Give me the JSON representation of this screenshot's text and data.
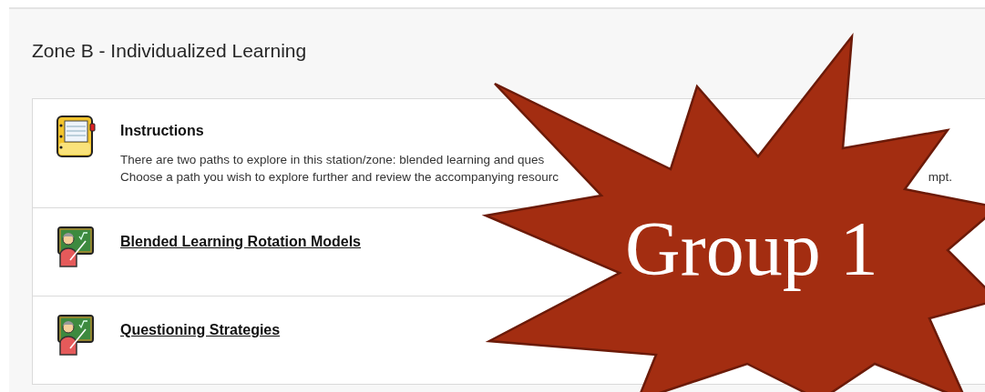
{
  "page_title": "Zone B - Individualized Learning",
  "items": [
    {
      "kind": "instructions",
      "title": "Instructions",
      "lines": [
        {
          "text": "There are two paths to explore in this station/zone: blended learning and ques"
        },
        {
          "text": "Choose a path you wish to explore further and review the accompanying resourc",
          "tail": "mpt."
        }
      ]
    },
    {
      "kind": "link",
      "title": "Blended Learning Rotation Models"
    },
    {
      "kind": "link",
      "title": "Questioning Strategies"
    }
  ],
  "overlay": {
    "label": "Group 1"
  }
}
